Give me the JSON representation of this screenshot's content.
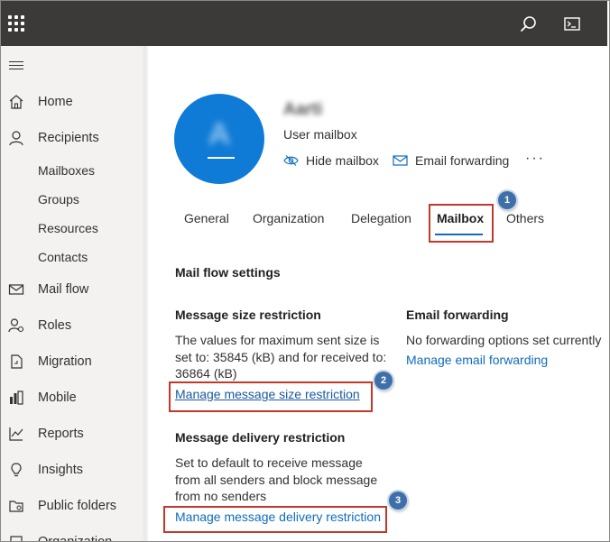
{
  "sidebar": {
    "items": [
      {
        "label": "Home"
      },
      {
        "label": "Recipients"
      },
      {
        "label": "Mail flow"
      },
      {
        "label": "Roles"
      },
      {
        "label": "Migration"
      },
      {
        "label": "Mobile"
      },
      {
        "label": "Reports"
      },
      {
        "label": "Insights"
      },
      {
        "label": "Public folders"
      },
      {
        "label": "Organization"
      }
    ],
    "recipients_children": [
      "Mailboxes",
      "Groups",
      "Resources",
      "Contacts"
    ]
  },
  "profile": {
    "avatar_initial": "A",
    "name": "Aarti",
    "type": "User mailbox",
    "actions": {
      "hide_mailbox": "Hide mailbox",
      "email_forwarding": "Email forwarding",
      "more": "···"
    }
  },
  "tabs": [
    "General",
    "Organization",
    "Delegation",
    "Mailbox",
    "Others"
  ],
  "active_tab": "Mailbox",
  "content": {
    "section_title": "Mail flow settings",
    "size_restriction": {
      "title": "Message size restriction",
      "lines": [
        "The values for maximum sent size is",
        "set to: 35845 (kB) and for received to:",
        "36864 (kB)"
      ],
      "link": "Manage message size restriction"
    },
    "forwarding": {
      "title": "Email forwarding",
      "text": "No forwarding options set currently",
      "link": "Manage email forwarding"
    },
    "delivery_restriction": {
      "title": "Message delivery restriction",
      "lines": [
        "Set to default to receive message",
        "from all senders and block message",
        "from no senders"
      ],
      "link": "Manage message delivery restriction"
    }
  },
  "callouts": {
    "one": "1",
    "two": "2",
    "three": "3"
  },
  "colors": {
    "topbar": "#3b3a39",
    "sidebar": "#f3f2f1",
    "accent": "#0f6cbd",
    "avatar": "#0f7bd6",
    "highlight": "#c0392b"
  }
}
